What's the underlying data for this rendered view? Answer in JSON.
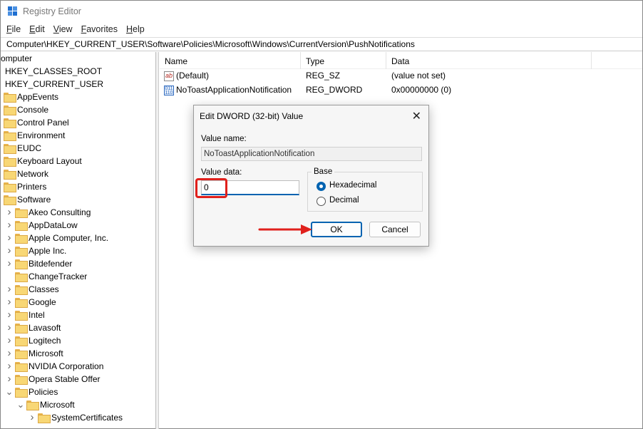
{
  "window": {
    "title": "Registry Editor",
    "menu": [
      "File",
      "Edit",
      "View",
      "Favorites",
      "Help"
    ],
    "address": "Computer\\HKEY_CURRENT_USER\\Software\\Policies\\Microsoft\\Windows\\CurrentVersion\\PushNotifications"
  },
  "tree": {
    "items": [
      {
        "label": "omputer",
        "depth": 0,
        "icon": "none",
        "chevron": "none"
      },
      {
        "label": "HKEY_CLASSES_ROOT",
        "depth": 0,
        "icon": "none",
        "chevron": "none"
      },
      {
        "label": "HKEY_CURRENT_USER",
        "depth": 0,
        "icon": "none",
        "chevron": "none"
      },
      {
        "label": "AppEvents",
        "depth": 0,
        "icon": "folder",
        "chevron": "none"
      },
      {
        "label": "Console",
        "depth": 0,
        "icon": "folder",
        "chevron": "none"
      },
      {
        "label": "Control Panel",
        "depth": 0,
        "icon": "folder",
        "chevron": "none"
      },
      {
        "label": "Environment",
        "depth": 0,
        "icon": "folder",
        "chevron": "none"
      },
      {
        "label": "EUDC",
        "depth": 0,
        "icon": "folder",
        "chevron": "none"
      },
      {
        "label": "Keyboard Layout",
        "depth": 0,
        "icon": "folder",
        "chevron": "none"
      },
      {
        "label": "Network",
        "depth": 0,
        "icon": "folder",
        "chevron": "none"
      },
      {
        "label": "Printers",
        "depth": 0,
        "icon": "folder",
        "chevron": "none"
      },
      {
        "label": "Software",
        "depth": 0,
        "icon": "folder",
        "chevron": "none"
      },
      {
        "label": "Akeo Consulting",
        "depth": 1,
        "icon": "folder",
        "chevron": "collapsed"
      },
      {
        "label": "AppDataLow",
        "depth": 1,
        "icon": "folder",
        "chevron": "collapsed"
      },
      {
        "label": "Apple Computer, Inc.",
        "depth": 1,
        "icon": "folder",
        "chevron": "collapsed"
      },
      {
        "label": "Apple Inc.",
        "depth": 1,
        "icon": "folder",
        "chevron": "collapsed"
      },
      {
        "label": "Bitdefender",
        "depth": 1,
        "icon": "folder",
        "chevron": "collapsed"
      },
      {
        "label": "ChangeTracker",
        "depth": 1,
        "icon": "folder",
        "chevron": "none"
      },
      {
        "label": "Classes",
        "depth": 1,
        "icon": "folder",
        "chevron": "collapsed"
      },
      {
        "label": "Google",
        "depth": 1,
        "icon": "folder",
        "chevron": "collapsed"
      },
      {
        "label": "Intel",
        "depth": 1,
        "icon": "folder",
        "chevron": "collapsed"
      },
      {
        "label": "Lavasoft",
        "depth": 1,
        "icon": "folder",
        "chevron": "collapsed"
      },
      {
        "label": "Logitech",
        "depth": 1,
        "icon": "folder",
        "chevron": "collapsed"
      },
      {
        "label": "Microsoft",
        "depth": 1,
        "icon": "folder",
        "chevron": "collapsed"
      },
      {
        "label": "NVIDIA Corporation",
        "depth": 1,
        "icon": "folder",
        "chevron": "collapsed"
      },
      {
        "label": "Opera Stable Offer",
        "depth": 1,
        "icon": "folder",
        "chevron": "collapsed"
      },
      {
        "label": "Policies",
        "depth": 1,
        "icon": "folder",
        "chevron": "expanded"
      },
      {
        "label": "Microsoft",
        "depth": 2,
        "icon": "folder",
        "chevron": "expanded"
      },
      {
        "label": "SystemCertificates",
        "depth": 3,
        "icon": "folder",
        "chevron": "collapsed"
      }
    ]
  },
  "list": {
    "columns": [
      "Name",
      "Type",
      "Data"
    ],
    "rows": [
      {
        "icon": "string-value-icon",
        "name": "(Default)",
        "type": "REG_SZ",
        "data": "(value not set)"
      },
      {
        "icon": "binary-value-icon",
        "name": "NoToastApplicationNotification",
        "type": "REG_DWORD",
        "data": "0x00000000 (0)"
      }
    ]
  },
  "dialog": {
    "title": "Edit DWORD (32-bit) Value",
    "value_name_label": "Value name:",
    "value_name": "NoToastApplicationNotification",
    "value_data_label": "Value data:",
    "value_data": "0",
    "base_label": "Base",
    "options": [
      {
        "label": "Hexadecimal",
        "selected": true
      },
      {
        "label": "Decimal",
        "selected": false
      }
    ],
    "ok_label": "OK",
    "cancel_label": "Cancel"
  },
  "colors": {
    "accent": "#0063b1",
    "highlight": "#e0201c",
    "folder": "#f8d775"
  }
}
